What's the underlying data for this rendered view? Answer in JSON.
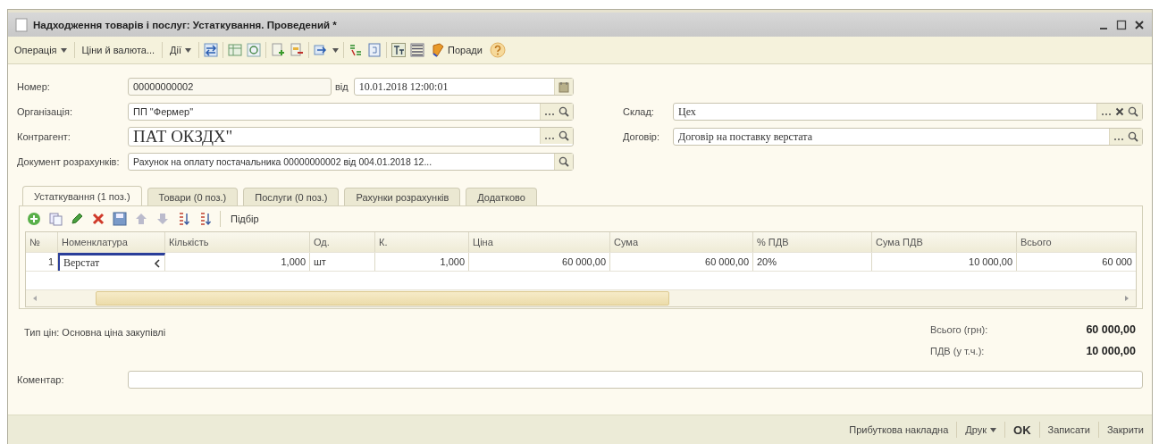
{
  "window": {
    "title": "Надходження товарів і послуг: Устаткування. Проведений *"
  },
  "toolbar": {
    "operation_menu": "Операція",
    "prices_button": "Ціни й валюта...",
    "actions_menu": "Дії",
    "tips_button": "Поради"
  },
  "header": {
    "number": {
      "label": "Номер:",
      "value": "00000000002"
    },
    "date": {
      "label": "від",
      "value": "10.01.2018  12:00:01"
    },
    "organization": {
      "label": "Організація:",
      "value": "ПП \"Фермер\""
    },
    "contractor": {
      "label": "Контрагент:",
      "value": "ПАТ ОКЗДХ\""
    },
    "document": {
      "label": "Документ розрахунків:",
      "value": "Рахунок на оплату постачальника 00000000002 від 004.01.2018 12..."
    },
    "warehouse": {
      "label": "Склад:",
      "value": "Цех"
    },
    "contract": {
      "label": "Договір:",
      "value": "Договір на поставку верстата"
    }
  },
  "tabs": [
    {
      "label": "Устаткування (1 поз.)",
      "selected": true
    },
    {
      "label": "Товари (0 поз.)",
      "selected": false
    },
    {
      "label": "Послуги (0 поз.)",
      "selected": false
    },
    {
      "label": "Рахунки розрахунків",
      "selected": false
    },
    {
      "label": "Додатково",
      "selected": false
    }
  ],
  "table_toolbar": {
    "pick_button": "Підбір"
  },
  "table": {
    "columns": [
      "№",
      "Номенклатура",
      "Кількість",
      "Од.",
      "К.",
      "Ціна",
      "Сума",
      "% ПДВ",
      "Сума ПДВ",
      "Всього"
    ],
    "rows": [
      [
        "1",
        "Верстат",
        "1,000",
        "шт",
        "1,000",
        "60 000,00",
        "60 000,00",
        "20%",
        "10 000,00",
        "60 000"
      ]
    ]
  },
  "price_type": "Тип цін: Основна ціна закупівлі",
  "totals": [
    {
      "label": "Всього (грн):",
      "value": "60 000,00"
    },
    {
      "label": "ПДВ (у т.ч.):",
      "value": "10 000,00"
    }
  ],
  "comment": {
    "label": "Коментар:"
  },
  "bottom_bar": [
    {
      "label": "Прибуткова накладна",
      "kind": "button"
    },
    {
      "label": "Друк",
      "kind": "menu"
    },
    {
      "label": "OK",
      "kind": "default"
    },
    {
      "label": "Записати",
      "kind": "button"
    },
    {
      "label": "Закрити",
      "kind": "button"
    }
  ]
}
